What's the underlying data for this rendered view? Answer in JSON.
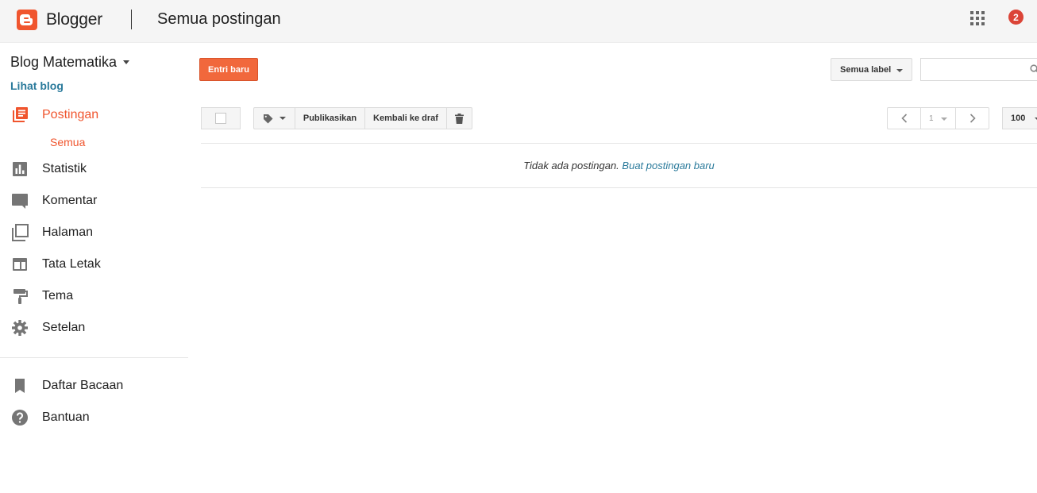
{
  "header": {
    "app_name": "Blogger",
    "page_title": "Semua postingan",
    "notifications_count": "2",
    "brand_color": "#f0552e",
    "apps_icon": "apps-grid-icon"
  },
  "sidebar": {
    "blog_name": "Blog Matematika",
    "view_blog": "Lihat blog",
    "items": [
      {
        "label": "Postingan",
        "icon": "posts-icon",
        "active": true
      },
      {
        "label": "Statistik",
        "icon": "stats-icon"
      },
      {
        "label": "Komentar",
        "icon": "comments-icon"
      },
      {
        "label": "Halaman",
        "icon": "pages-icon"
      },
      {
        "label": "Tata Letak",
        "icon": "layout-icon"
      },
      {
        "label": "Tema",
        "icon": "theme-roller-icon"
      },
      {
        "label": "Setelan",
        "icon": "gear-icon"
      }
    ],
    "sub_item": "Semua",
    "secondary_items": [
      {
        "label": "Daftar Bacaan",
        "icon": "bookmark-icon"
      },
      {
        "label": "Bantuan",
        "icon": "help-icon"
      }
    ]
  },
  "main": {
    "new_post": "Entri baru",
    "label_filter": "Semua label",
    "search_value": "",
    "toolbar": {
      "publish": "Publikasikan",
      "revert_to_draft": "Kembali ke draf"
    },
    "pager": {
      "page": "1",
      "per_page": "100"
    },
    "empty_message": "Tidak ada postingan.",
    "empty_link": "Buat postingan baru"
  },
  "colors": {
    "accent": "#f0552e",
    "link": "#2a7a9b",
    "button_orange": "#f1683c",
    "badge_red": "#db4437"
  }
}
